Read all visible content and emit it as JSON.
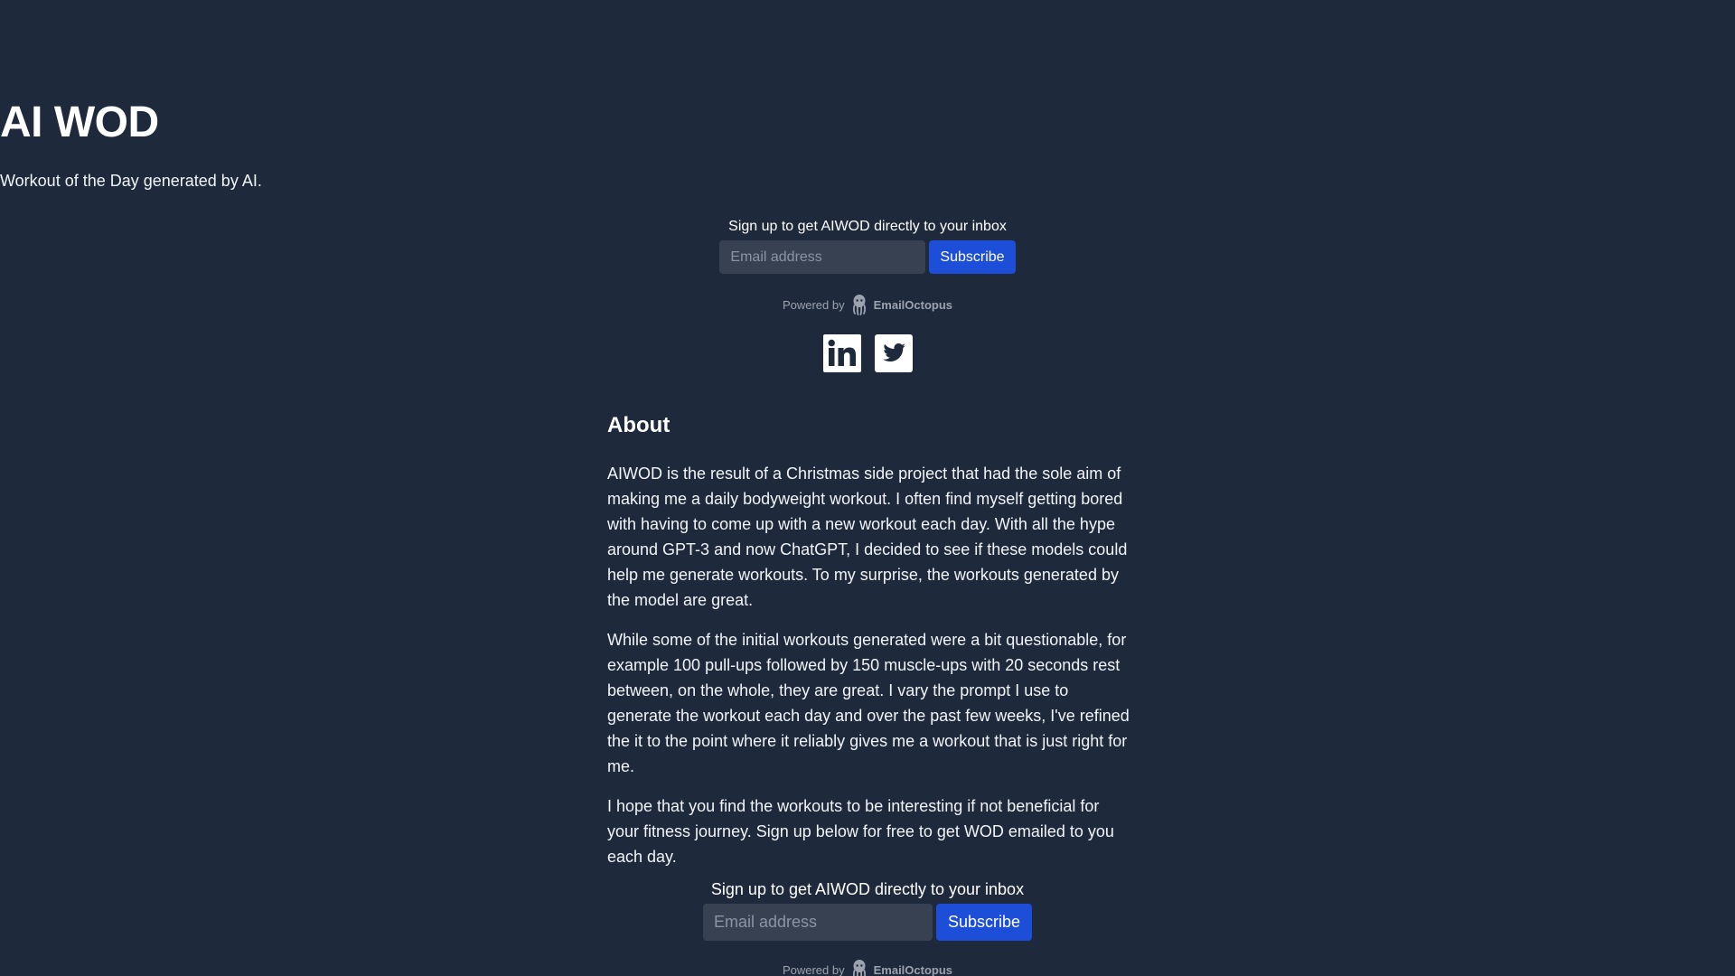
{
  "site": {
    "title": "AI WOD",
    "tagline": "Workout of the Day generated by AI."
  },
  "signup_top": {
    "label": "Sign up to get AIWOD directly to your inbox",
    "email_placeholder": "Email address",
    "button_label": "Subscribe",
    "powered_by": "Powered by",
    "provider": "EmailOctopus"
  },
  "social": {
    "items": [
      {
        "name": "linkedin-icon"
      },
      {
        "name": "twitter-icon"
      }
    ]
  },
  "about": {
    "heading": "About",
    "paragraphs": [
      "AIWOD is the result of a Christmas side project that had the sole aim of making me a daily bodyweight workout. I often find myself getting bored with having to come up with a new workout each day. With all the hype around GPT-3 and now ChatGPT, I decided to see if these models could help me generate workouts. To my surprise, the workouts generated by the model are great.",
      "While some of the initial workouts generated were a bit questionable, for example 100 pull-ups followed by 150 muscle-ups with 20 seconds rest between, on the whole, they are great. I vary the prompt I use to generate the workout each day and over the past few weeks, I've refined the it to the point where it reliably gives me a workout that is just right for me.",
      "I hope that you find the workouts to be interesting if not beneficial for your fitness journey. Sign up below for free to get WOD emailed to you each day."
    ]
  },
  "signup_bottom": {
    "label": "Sign up to get AIWOD directly to your inbox",
    "email_placeholder": "Email address",
    "button_label": "Subscribe",
    "powered_by": "Powered by",
    "provider": "EmailOctopus"
  },
  "colors": {
    "background": "#1e293b",
    "input_bg": "#374151",
    "button_bg": "#1d4ed8",
    "text": "#ffffff",
    "muted": "#9ca3af"
  }
}
